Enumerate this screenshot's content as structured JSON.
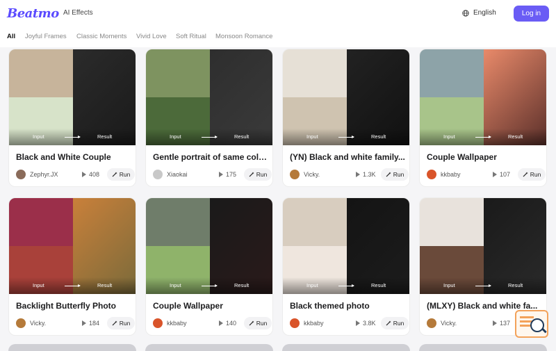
{
  "header": {
    "logo": "Beatmo",
    "nav_link": "AI Effects",
    "language": "English",
    "login": "Log in"
  },
  "tabs": [
    "All",
    "Joyful Frames",
    "Classic Moments",
    "Vivid Love",
    "Soft Ritual",
    "Monsoon Romance"
  ],
  "card_labels": {
    "input": "Input",
    "result": "Result",
    "run": "Run"
  },
  "cards": [
    {
      "title": "Black and White Couple",
      "author": "Zephyr.JX",
      "plays": "408"
    },
    {
      "title": "Gentle portrait of same colo...",
      "author": "Xiaokai",
      "plays": "175"
    },
    {
      "title": "(YN) Black and white family...",
      "author": "Vicky.",
      "plays": "1.3K"
    },
    {
      "title": "Couple Wallpaper",
      "author": "kkbaby",
      "plays": "107"
    },
    {
      "title": "Backlight Butterfly Photo",
      "author": "Vicky.",
      "plays": "184"
    },
    {
      "title": "Couple Wallpaper",
      "author": "kkbaby",
      "plays": "140"
    },
    {
      "title": "Black themed photo",
      "author": "kkbaby",
      "plays": "3.8K"
    },
    {
      "title": "(MLXY) Black and white fa...",
      "author": "Vicky.",
      "plays": "137"
    }
  ],
  "colors": {
    "brand": "#5b4bff",
    "login_bg": "#6a5cf5",
    "float_accent": "#f3a25a"
  },
  "icons": [
    "globe-icon",
    "play-icon",
    "run-wand-icon",
    "feedback-search-icon"
  ]
}
